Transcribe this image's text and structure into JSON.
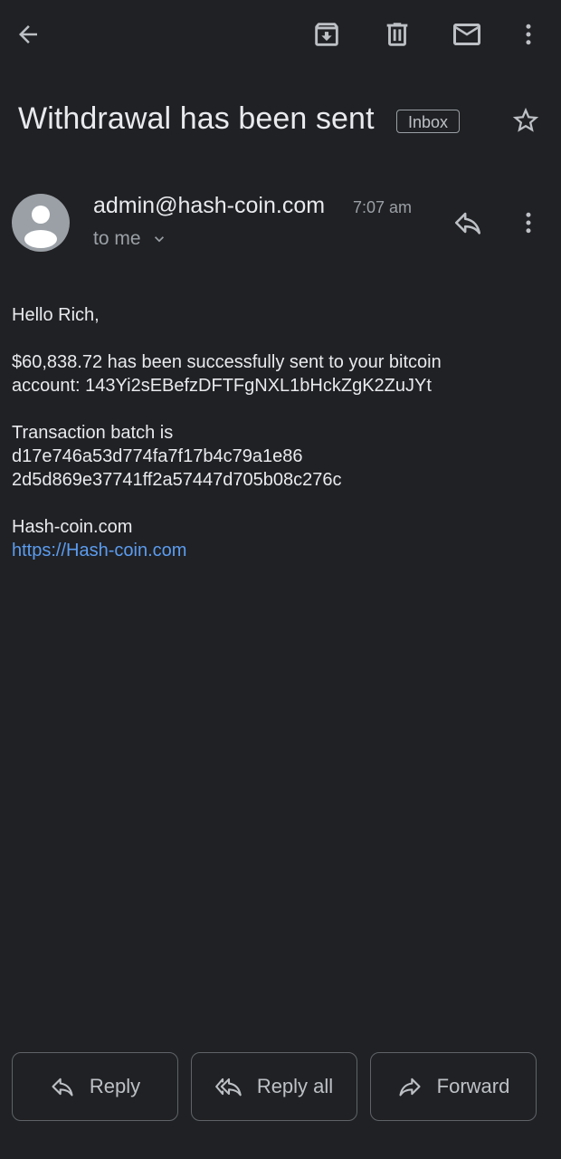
{
  "toolbar": {
    "back_icon": "arrow-back-icon",
    "archive_icon": "archive-icon",
    "delete_icon": "trash-icon",
    "mark_unread_icon": "mail-icon",
    "overflow_icon": "more-vert-icon"
  },
  "subject": {
    "title": "Withdrawal has been sent",
    "label": "Inbox",
    "star_icon": "star-outline-icon"
  },
  "message": {
    "sender": "admin@hash-coin.com",
    "time": "7:07 am",
    "recipient": "to me",
    "body": {
      "greeting": "Hello Rich,",
      "line1": "$60,838.72 has been successfully sent to your bitcoin",
      "line2": "account: 143Yi2sEBefzDFTFgNXL1bHckZgK2ZuJYt",
      "batch_label": "Transaction batch is",
      "batch_line1": "d17e746a53d774fa7f17b4c79a1e86",
      "batch_line2": "2d5d869e37741ff2a57447d705b08c276c",
      "signature": "Hash-coin.com",
      "link": "https://Hash-coin.com"
    }
  },
  "actions": {
    "reply": "Reply",
    "reply_all": "Reply all",
    "forward": "Forward"
  },
  "colors": {
    "background": "#202124",
    "text": "#e8eaed",
    "secondary_text": "#9aa0a6",
    "link": "#5b9cf0",
    "border": "#5f6368"
  }
}
